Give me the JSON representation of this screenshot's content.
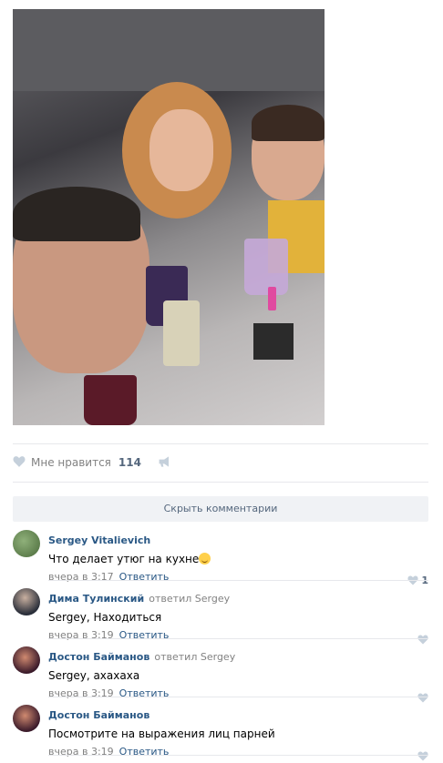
{
  "post": {
    "photo_icon": "photo-image",
    "likes_label": "Мне нравится",
    "likes_count": "114",
    "hide_comments": "Скрыть комментарии"
  },
  "comments": [
    {
      "author": "Sergey Vitalievich",
      "reply_to": "",
      "text": "Что делает утюг на кухне",
      "has_emoji": true,
      "time": "вчера в 3:17",
      "reply": "Ответить",
      "likes": "1",
      "avatar_color": "#6a8a5a"
    },
    {
      "author": "Дима Тулинский",
      "reply_to": "ответил Sergey",
      "text": "Sergey, Находиться",
      "has_emoji": false,
      "time": "вчера в 3:19",
      "reply": "Ответить",
      "likes": "",
      "avatar_color": "#3a3f4a"
    },
    {
      "author": "Достон Байманов",
      "reply_to": "ответил Sergey",
      "text": "Sergey, ахахаха",
      "has_emoji": false,
      "time": "вчера в 3:19",
      "reply": "Ответить",
      "likes": "",
      "avatar_color": "#4a2a3a"
    },
    {
      "author": "Достон Байманов",
      "reply_to": "",
      "text": "Посмотрите на выражения лиц парней",
      "has_emoji": false,
      "time": "вчера в 3:19",
      "reply": "Ответить",
      "likes": "",
      "avatar_color": "#4a2a3a"
    }
  ],
  "colors": {
    "link": "#2a5885",
    "muted": "#828282",
    "heart": "#c5d0db"
  }
}
